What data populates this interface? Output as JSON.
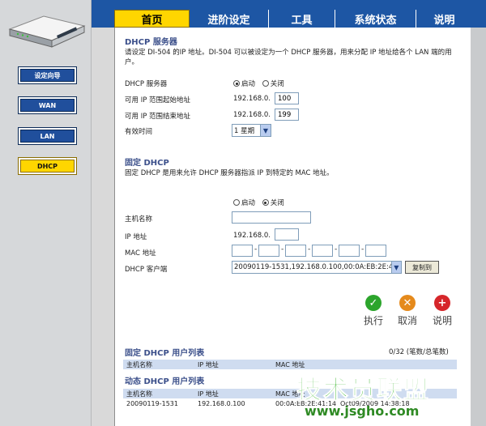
{
  "tabs": [
    {
      "label": "首页"
    },
    {
      "label": "进阶设定"
    },
    {
      "label": "工具"
    },
    {
      "label": "系统状态"
    },
    {
      "label": "说明"
    }
  ],
  "sidebar": {
    "items": [
      {
        "label": "设定向导"
      },
      {
        "label": "WAN"
      },
      {
        "label": "LAN"
      },
      {
        "label": "DHCP"
      }
    ]
  },
  "dhcp_server": {
    "title": "DHCP 服务器",
    "desc": "请设定 DI-504 的IP 地址。DI-504 可以被设定为一个 DHCP 服务器，用来分配 IP 地址给各个 LAN 端的用户。",
    "server_label": "DHCP 服务器",
    "enable_label": "启动",
    "disable_label": "关闭",
    "start_label": "可用 IP 范围起始地址",
    "start_prefix": "192.168.0.",
    "start_value": "100",
    "end_label": "可用 IP 范围结束地址",
    "end_prefix": "192.168.0.",
    "end_value": "199",
    "lease_label": "有效时间",
    "lease_value": "1 星期"
  },
  "static_dhcp": {
    "title": "固定 DHCP",
    "desc": "固定 DHCP 是用来允许 DHCP 服务器指派 IP 到特定的 MAC 地址。",
    "enable_label": "启动",
    "disable_label": "关闭",
    "hostname_label": "主机名称",
    "ip_label": "IP 地址",
    "ip_prefix": "192.168.0.",
    "mac_label": "MAC 地址",
    "client_label": "DHCP 客户端",
    "client_value": "20090119-1531,192.168.0.100,00:0A:EB:2E:41:",
    "copy_button": "复制到"
  },
  "actions": {
    "apply": "执行",
    "cancel": "取消",
    "help": "说明"
  },
  "static_list": {
    "title": "固定 DHCP 用户列表",
    "count": "0/32 (笔数/总笔数)",
    "headers": [
      "主机名称",
      "IP 地址",
      "MAC 地址"
    ]
  },
  "dynamic_list": {
    "title": "动态 DHCP 用户列表",
    "headers": [
      "主机名称",
      "IP 地址",
      "MAC 地址"
    ],
    "rows": [
      {
        "host": "20090119-1531",
        "ip": "192.168.0.100",
        "mac": "00:0A:EB:2E:41:14",
        "time": "Oct09/2009 14:38:18"
      }
    ]
  },
  "watermark": {
    "text": "技术员联盟",
    "url": "www.jsgho.com"
  },
  "colors": {
    "nav_blue": "#1d56a4",
    "active_yellow": "#ffd600",
    "section_title": "#3b4f8a",
    "table_header": "#cfdcf0"
  }
}
